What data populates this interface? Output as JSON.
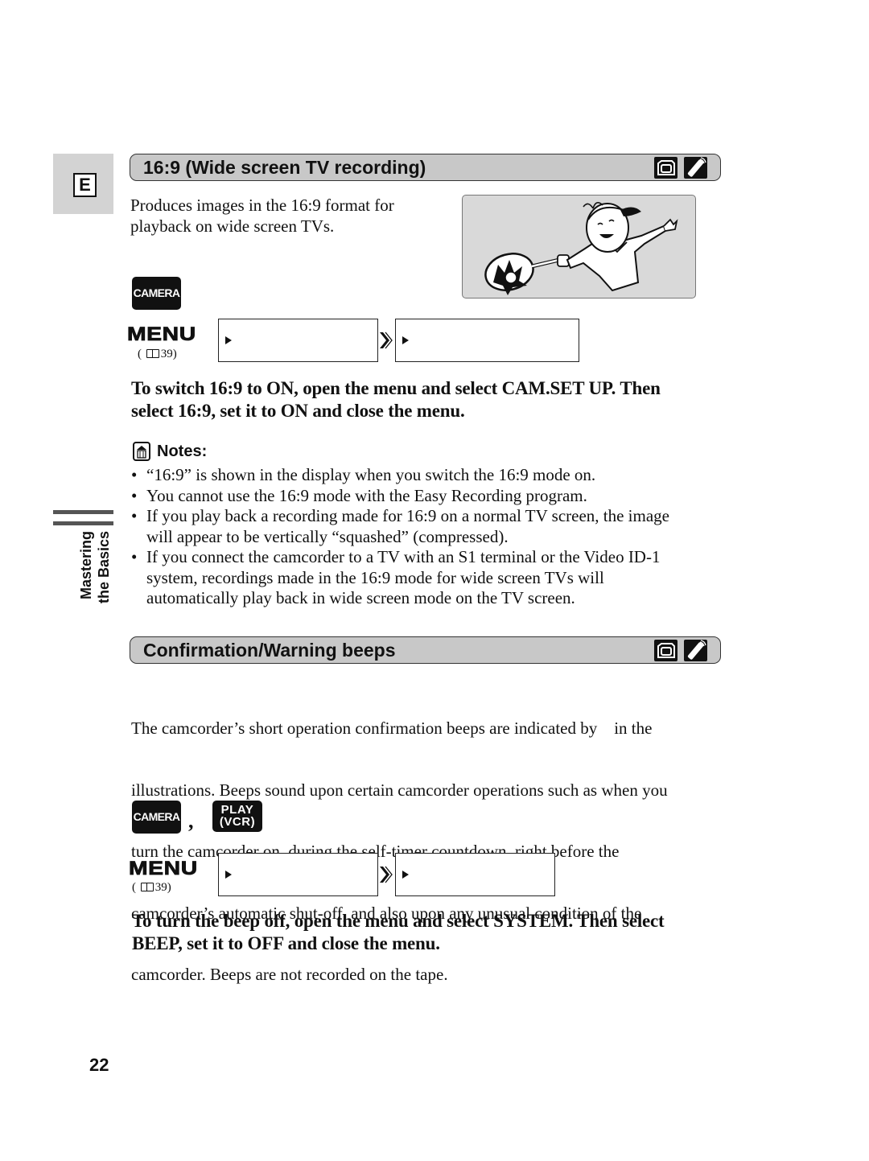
{
  "language_tab": "E",
  "side_tab": {
    "lines": [
      "Mastering",
      "the Basics"
    ]
  },
  "section1": {
    "title": "16:9 (Wide screen TV recording)",
    "icons": [
      "camcorder-icon",
      "remote-control-icon"
    ],
    "intro": [
      "Produces images in the 16:9 format for",
      "playback on wide screen TVs."
    ],
    "mode_buttons": [
      {
        "label": "CAMERA"
      }
    ],
    "menu": {
      "label": "MENU",
      "ref_prefix": "(",
      "ref_page": "39)",
      "steps": [
        {
          "text": ""
        },
        {
          "text": ""
        }
      ]
    },
    "instruction": [
      "To switch 16:9 to ON, open the menu and select CAM.SET UP. Then",
      "select 16:9, set it to ON and close the menu."
    ],
    "notes_title": "Notes:",
    "notes": [
      [
        "“16:9” is shown in the display when you switch the 16:9 mode on."
      ],
      [
        "You cannot use the 16:9 mode with the Easy Recording program."
      ],
      [
        "If you play back a recording made for 16:9 on a normal TV screen, the image",
        "will appear to be vertically “squashed” (compressed)."
      ],
      [
        "If you connect the camcorder to a TV with an S1 terminal or the Video ID-1",
        "system, recordings made in the 16:9 mode for wide screen TVs will",
        "automatically play back in wide screen mode on the TV screen."
      ]
    ]
  },
  "section2": {
    "title": "Confirmation/Warning beeps",
    "icons": [
      "camcorder-icon",
      "remote-control-icon"
    ],
    "body": [
      "The camcorder’s short operation confirmation beeps are indicated by    in the",
      "illustrations. Beeps sound upon certain camcorder operations such as when you",
      "turn the camcorder on, during the self-timer countdown, right before the",
      "camcorder’s automatic shut-off, and also upon any unusual condition of the",
      "camcorder. Beeps are not recorded on the tape."
    ],
    "mode_buttons": [
      {
        "label": "CAMERA"
      },
      {
        "label_line1": "PLAY",
        "label_line2": "(VCR)"
      }
    ],
    "mode_separator": ",",
    "menu": {
      "label": "MENU",
      "ref_prefix": "(",
      "ref_page": "39)",
      "steps": [
        {
          "text": ""
        },
        {
          "text": ""
        }
      ]
    },
    "instruction": [
      "To turn the beep off, open the menu and select SYSTEM. Then select",
      "BEEP, set it to OFF and close the menu."
    ]
  },
  "page_number": "22",
  "colors": {
    "header_bg": "#c8c8c8",
    "tab_bg": "#d3d3d3",
    "illustration_bg": "#d9d9d9",
    "button_bg": "#111111"
  }
}
